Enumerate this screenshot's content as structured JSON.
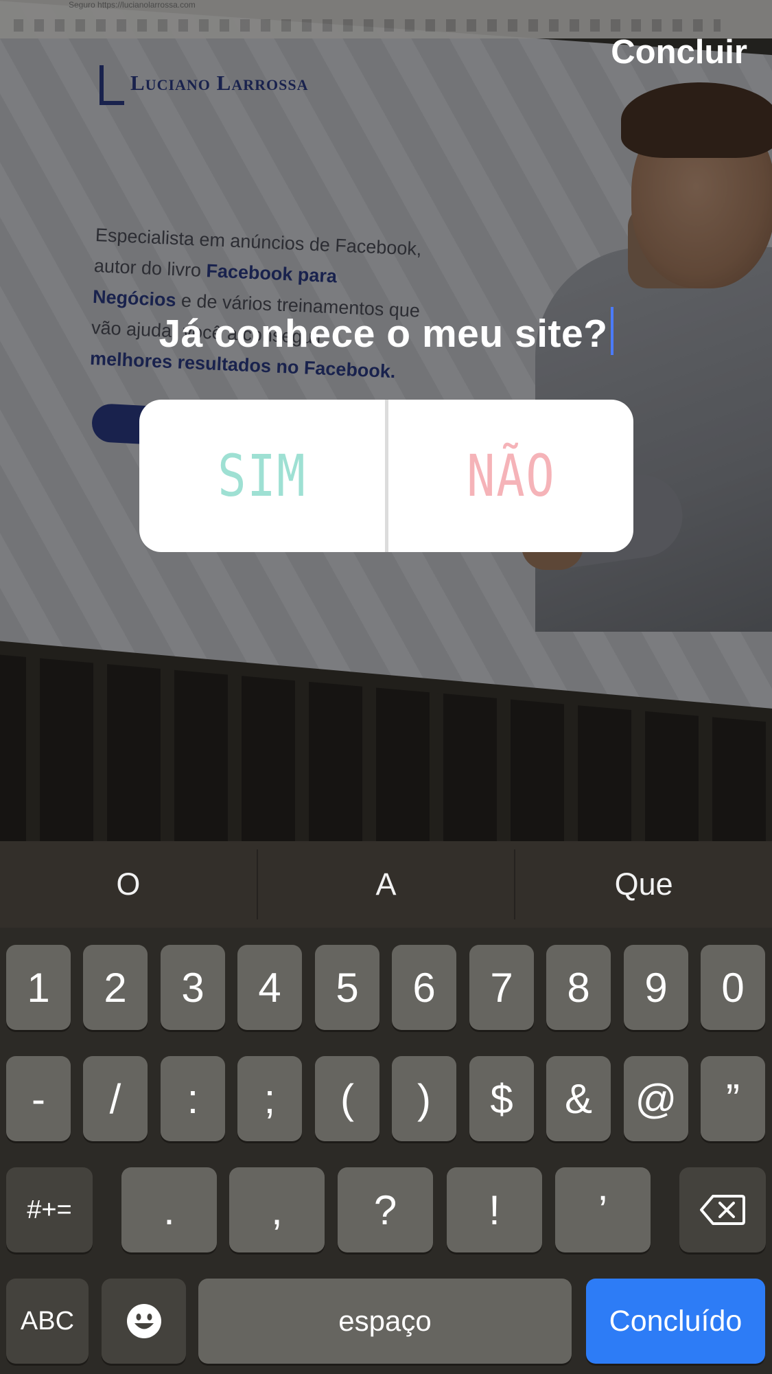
{
  "background": {
    "browser_url": "Seguro  https://lucianolarrossa.com",
    "site_logo": "Luciano Larrossa",
    "site_copy": {
      "l1": "Especialista em anúncios de Facebook,",
      "l2a": "autor do livro ",
      "l2b": "Facebook para",
      "l3a": "Negócios",
      "l3b": " e de vários treinamentos que",
      "l4": "vão ajudar você a conseguir",
      "l5": "melhores resultados no Facebook."
    }
  },
  "toolbar": {
    "done_label": "Concluir"
  },
  "poll": {
    "question": "Já conhece o meu site?",
    "option_yes": "SIM",
    "option_no": "NÃO",
    "colors": {
      "yes": "#9ee0d3",
      "no": "#f5b3b8"
    }
  },
  "keyboard": {
    "predictions": [
      "O",
      "A",
      "Que"
    ],
    "row1": [
      "1",
      "2",
      "3",
      "4",
      "5",
      "6",
      "7",
      "8",
      "9",
      "0"
    ],
    "row2": [
      "-",
      "/",
      ":",
      ";",
      "(",
      ")",
      "$",
      "&",
      "@",
      "”"
    ],
    "row3": [
      "#+=",
      ".",
      ",",
      "?",
      "!",
      "’"
    ],
    "abc_label": "ABC",
    "space_label": "espaço",
    "done_label": "Concluído",
    "accent_color": "#2d7cf6"
  }
}
